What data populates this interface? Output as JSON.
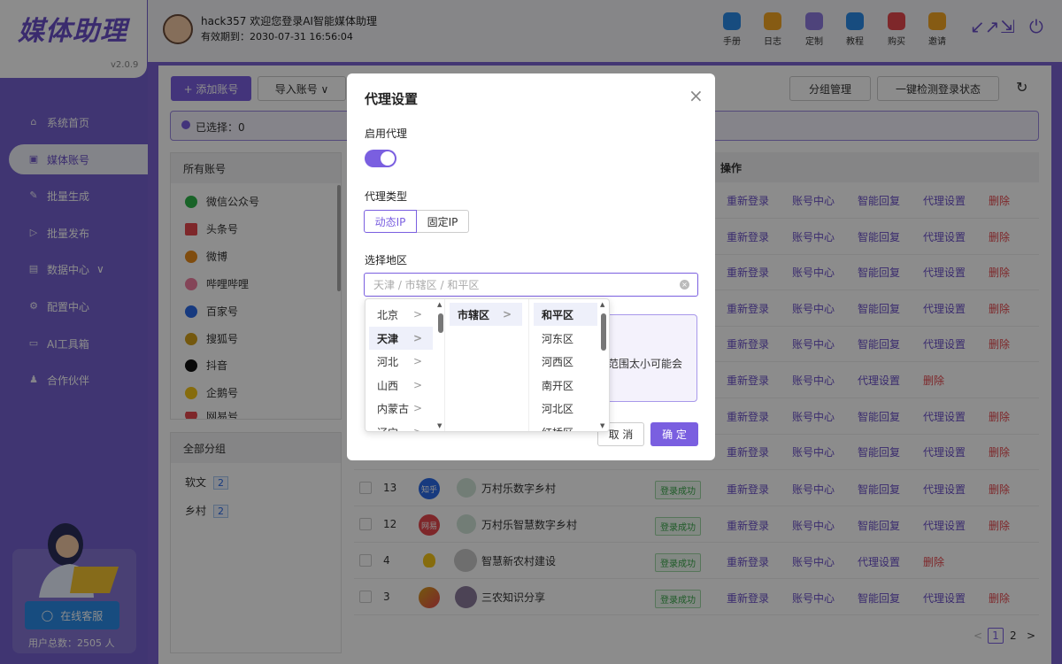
{
  "app": {
    "logo": "媒体助理",
    "version": "v2.0.9"
  },
  "user": {
    "welcome": "hack357 欢迎您登录AI智能媒体助理",
    "expiry": "有效期到：2030-07-31 16:56:04"
  },
  "toolbar": [
    {
      "label": "手册",
      "icon": "manual-icon",
      "color": "#2b8be8"
    },
    {
      "label": "日志",
      "icon": "log-icon",
      "color": "#f5a623"
    },
    {
      "label": "定制",
      "icon": "custom-icon",
      "color": "#8e7be0"
    },
    {
      "label": "教程",
      "icon": "tutorial-icon",
      "color": "#2b8be8"
    },
    {
      "label": "购买",
      "icon": "buy-icon",
      "color": "#e5484d"
    },
    {
      "label": "邀请",
      "icon": "invite-icon",
      "color": "#f5a623"
    }
  ],
  "window": {
    "minimize": "↙↗",
    "restore": "⇲",
    "power": "⏻"
  },
  "nav": [
    {
      "label": "系统首页",
      "icon": "home-icon",
      "glyph": "⌂"
    },
    {
      "label": "媒体账号",
      "icon": "account-icon",
      "glyph": "▣",
      "active": true
    },
    {
      "label": "批量生成",
      "icon": "edit-icon",
      "glyph": "✎"
    },
    {
      "label": "批量发布",
      "icon": "send-icon",
      "glyph": "▷"
    },
    {
      "label": "数据中心",
      "icon": "data-icon",
      "glyph": "▤",
      "suffix": "∨"
    },
    {
      "label": "配置中心",
      "icon": "settings-icon",
      "glyph": "⚙"
    },
    {
      "label": "AI工具箱",
      "icon": "toolbox-icon",
      "glyph": "▭"
    },
    {
      "label": "合作伙伴",
      "icon": "partner-icon",
      "glyph": "♟"
    }
  ],
  "support": {
    "button": "在线客服",
    "total": "用户总数：2505 人"
  },
  "actions": {
    "add": "+ 添加账号",
    "import": "导入账号 ∨",
    "group": "分组管理",
    "check": "一键检测登录状态",
    "refresh": "↻"
  },
  "selected": "已选择：0",
  "accounts": {
    "title": "所有账号",
    "items": [
      {
        "label": "微信公众号",
        "color": "#2fb54a"
      },
      {
        "label": "头条号",
        "color": "#e5484d"
      },
      {
        "label": "微博",
        "color": "#e88a1a"
      },
      {
        "label": "哔哩哔哩",
        "color": "#f07ea0"
      },
      {
        "label": "百家号",
        "color": "#2b6be8"
      },
      {
        "label": "搜狐号",
        "color": "#d4a11a"
      },
      {
        "label": "抖音",
        "color": "#111111"
      },
      {
        "label": "企鹅号",
        "color": "#f5c518"
      },
      {
        "label": "网易号",
        "color": "#e5484d"
      }
    ]
  },
  "groups": {
    "title": "全部分组",
    "items": [
      {
        "label": "软文",
        "count": "2"
      },
      {
        "label": "乡村",
        "count": "2"
      }
    ]
  },
  "table": {
    "op_header": "操作",
    "ops": {
      "relogin": "重新登录",
      "center": "账号中心",
      "reply": "智能回复",
      "proxy": "代理设置",
      "delete": "删除"
    },
    "rows": [
      {
        "id": "13",
        "name": "万村乐数字乡村",
        "platform": "知乎",
        "pcolor": "#2b6be8",
        "status": "登录成功",
        "reply": true
      },
      {
        "id": "12",
        "name": "万村乐智慧数字乡村",
        "platform": "网易",
        "pcolor": "#e5484d",
        "status": "登录成功",
        "reply": true
      },
      {
        "id": "4",
        "name": "智慧新农村建设",
        "platform": "企鹅",
        "pcolor": "#f5c518",
        "status": "登录成功",
        "reply": false
      },
      {
        "id": "3",
        "name": "三农知识分享",
        "platform": "搜狐",
        "pcolor": "#d4a11a",
        "status": "登录成功",
        "reply": true
      }
    ],
    "upper_rows": [
      {
        "reply": true
      },
      {
        "reply": true
      },
      {
        "reply": true
      },
      {
        "reply": true
      },
      {
        "reply": true
      },
      {
        "reply": false
      },
      {
        "reply": true
      },
      {
        "reply": true
      }
    ]
  },
  "pagination": {
    "prev": "<",
    "current": "1",
    "next_page": "2",
    "next": ">"
  },
  "dialog": {
    "title": "代理设置",
    "close": "×",
    "enable_label": "启用代理",
    "enabled": true,
    "type_label": "代理类型",
    "types": [
      "动态IP",
      "固定IP"
    ],
    "selected_type": "动态IP",
    "region_label": "选择地区",
    "region_placeholder": "天津 / 市辖区 / 和平区",
    "hint_text": "范围太小可能会",
    "cancel": "取 消",
    "confirm": "确 定",
    "cascader": {
      "provinces": [
        "北京",
        "天津",
        "河北",
        "山西",
        "内蒙古",
        "辽宁"
      ],
      "selected_province": "天津",
      "cities": [
        "市辖区"
      ],
      "districts": [
        "和平区",
        "河东区",
        "河西区",
        "南开区",
        "河北区",
        "红桥区"
      ],
      "selected_district": "和平区"
    }
  }
}
